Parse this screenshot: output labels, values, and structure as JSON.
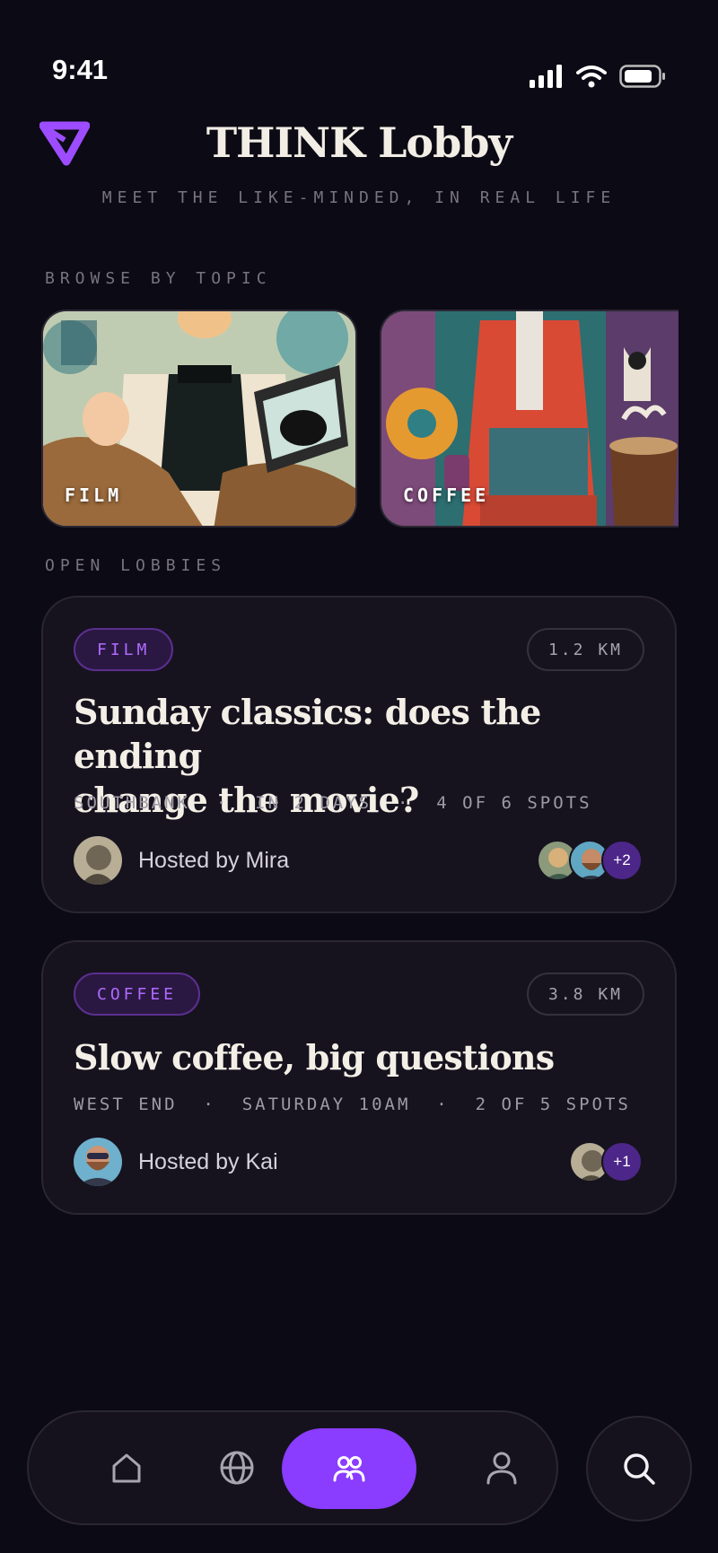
{
  "status_bar": {
    "time": "9:41"
  },
  "header": {
    "title": "THINK Lobby",
    "tagline": "MEET THE LIKE-MINDED, IN REAL LIFE"
  },
  "sections": {
    "browse": "BROWSE BY TOPIC",
    "open": "OPEN LOBBIES"
  },
  "topics": [
    {
      "label": "FILM"
    },
    {
      "label": "COFFEE"
    }
  ],
  "lobbies": [
    {
      "tag": "FILM",
      "distance": "1.2 KM",
      "title_lines": [
        "Sunday classics: does the ending",
        "change the movie?"
      ],
      "meta": "SOUTHBANK  ·  IN 2 DAYS  ·  4 OF 6 SPOTS",
      "host": "Hosted by Mira",
      "extra": "+2"
    },
    {
      "tag": "COFFEE",
      "distance": "3.8 KM",
      "title_lines": [
        "Slow coffee, big questions"
      ],
      "meta": "WEST END  ·  SATURDAY 10AM  ·  2 OF 5 SPOTS",
      "host": "Hosted by Kai",
      "extra": "+1"
    }
  ],
  "colors": {
    "accent": "#8a3cff",
    "background": "#0c0a14",
    "card": "#16131f"
  },
  "nav": {
    "icons": [
      "home-icon",
      "globe-icon",
      "people-icon",
      "profile-icon"
    ],
    "active": "people-icon",
    "search_icon": "search-icon"
  }
}
